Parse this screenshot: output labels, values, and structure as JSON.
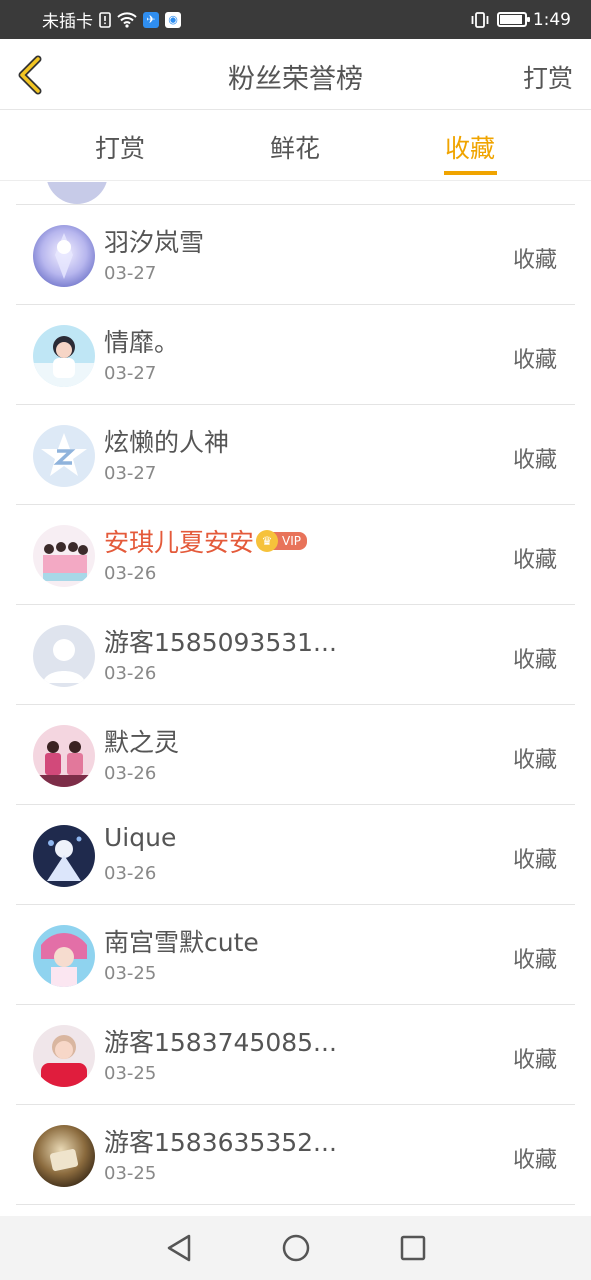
{
  "status_bar": {
    "carrier": "未插卡",
    "time": "1:49",
    "icons": [
      "sim-alert-icon",
      "wifi-icon",
      "app-notification-icon",
      "browser-notification-icon",
      "vibrate-icon",
      "battery-icon"
    ]
  },
  "header": {
    "title": "粉丝荣誉榜",
    "action_label": "打赏",
    "back_icon": "chevron-left-icon"
  },
  "tabs": [
    {
      "label": "打赏",
      "active": false
    },
    {
      "label": "鲜花",
      "active": false
    },
    {
      "label": "收藏",
      "active": true
    }
  ],
  "colors": {
    "accent": "#f0a400",
    "vip_name": "#e45a3a",
    "text": "#555555",
    "divider": "#e4e4e4"
  },
  "list": [
    {
      "name": "羽汐岚雪",
      "date": "03-27",
      "action": "收藏",
      "vip": false
    },
    {
      "name": "情靡。",
      "date": "03-27",
      "action": "收藏",
      "vip": false
    },
    {
      "name": "炫懒的人神",
      "date": "03-27",
      "action": "收藏",
      "vip": false
    },
    {
      "name": "安琪儿夏安安",
      "date": "03-26",
      "action": "收藏",
      "vip": true,
      "vip_label": "VIP"
    },
    {
      "name": "游客1585093531...",
      "date": "03-26",
      "action": "收藏",
      "vip": false
    },
    {
      "name": "默之灵",
      "date": "03-26",
      "action": "收藏",
      "vip": false
    },
    {
      "name": "Uique",
      "date": "03-26",
      "action": "收藏",
      "vip": false
    },
    {
      "name": "南宫雪默cute",
      "date": "03-25",
      "action": "收藏",
      "vip": false
    },
    {
      "name": "游客1583745085...",
      "date": "03-25",
      "action": "收藏",
      "vip": false
    },
    {
      "name": "游客1583635352...",
      "date": "03-25",
      "action": "收藏",
      "vip": false
    }
  ],
  "nav_bar": {
    "back": "back-triangle-icon",
    "home": "home-circle-icon",
    "recents": "recents-square-icon"
  }
}
